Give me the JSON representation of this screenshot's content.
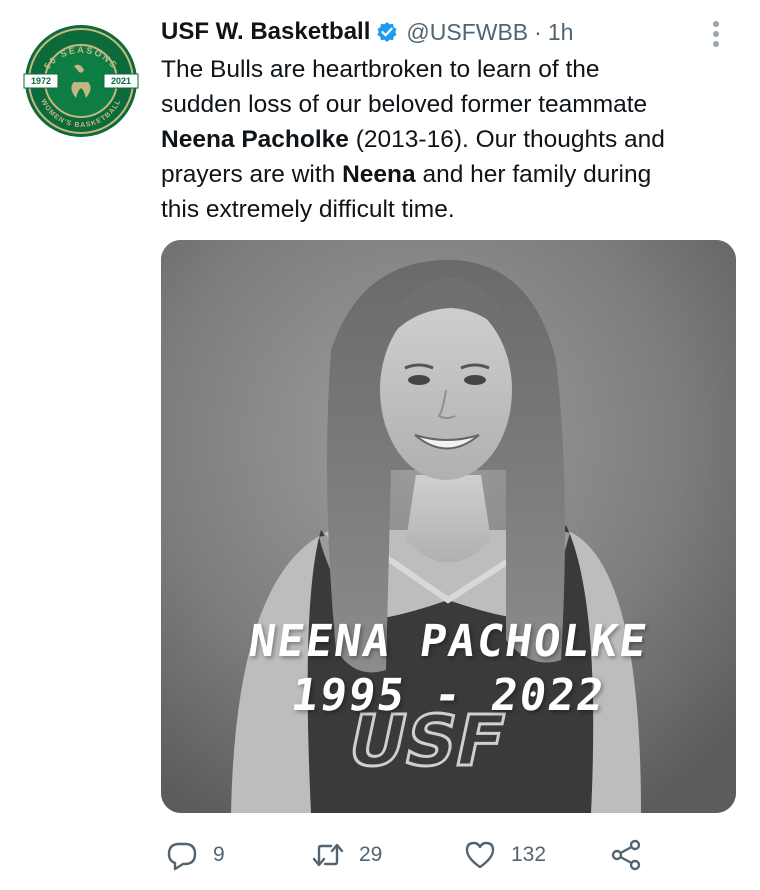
{
  "author": {
    "display_name": "USF W. Basketball",
    "handle": "@USFWBB",
    "separator": "·",
    "time": "1h",
    "avatar_logo": {
      "ring_top_text": "50 SEASONS",
      "ring_bottom_text": "WOMEN'S BASKETBALL",
      "year_left": "1972",
      "year_right": "2021"
    }
  },
  "tweet": {
    "lines": [
      {
        "segments": [
          {
            "text": "The Bulls are heartbroken to learn of the",
            "bold": false
          }
        ]
      },
      {
        "segments": [
          {
            "text": "sudden loss of our beloved former teammate",
            "bold": false
          }
        ]
      },
      {
        "segments": [
          {
            "text": "Neena Pacholke",
            "bold": true
          },
          {
            "text": " (2013-16). Our thoughts and",
            "bold": false
          }
        ]
      },
      {
        "segments": [
          {
            "text": "prayers are with ",
            "bold": false
          },
          {
            "text": "Neena",
            "bold": true
          },
          {
            "text": " and her family during",
            "bold": false
          }
        ]
      },
      {
        "segments": [
          {
            "text": "this extremely difficult time.",
            "bold": false
          }
        ]
      }
    ]
  },
  "media": {
    "overlay_name": "NEENA PACHOLKE",
    "overlay_years": "1995 - 2022",
    "jersey_logo": "USF"
  },
  "actions": {
    "reply": {
      "icon": "reply-icon",
      "count": "9"
    },
    "retweet": {
      "icon": "retweet-icon",
      "count": "29"
    },
    "like": {
      "icon": "heart-icon",
      "count": "132"
    },
    "share": {
      "icon": "share-icon"
    }
  },
  "colors": {
    "text": "#0f1419",
    "secondary": "#536471",
    "verified": "#1d9bf0",
    "logo_green": "#0b6b3a",
    "logo_gold": "#c5b783"
  }
}
